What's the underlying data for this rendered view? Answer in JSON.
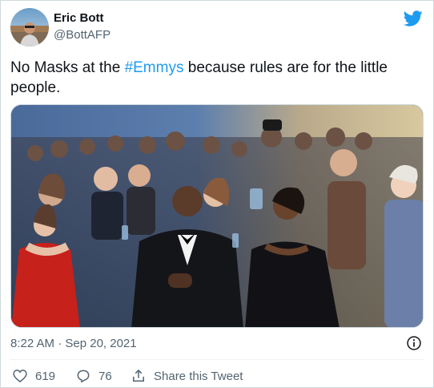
{
  "author": {
    "name": "Eric Bott",
    "handle": "@BottAFP"
  },
  "tweet": {
    "text_before": "No Masks at the ",
    "hashtag": "#Emmys",
    "text_after": " because rules are for the little people."
  },
  "timestamp": "8:22 AM · Sep 20, 2021",
  "actions": {
    "like_count": "619",
    "reply_count": "76",
    "share_label": "Share this Tweet"
  },
  "colors": {
    "accent": "#1d9bf0",
    "secondary_text": "#536471",
    "primary_text": "#0f1419"
  },
  "icons": {
    "logo": "twitter-bird-icon",
    "info": "info-icon",
    "like": "heart-icon",
    "reply": "reply-bubble-icon",
    "share": "share-icon"
  }
}
